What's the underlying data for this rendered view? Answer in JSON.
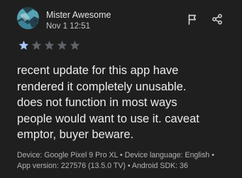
{
  "review": {
    "author": "Mister Awesome",
    "date": "Nov 1 12:51",
    "rating": 1,
    "max_rating": 5,
    "star_filled_color": "#a8c7fa",
    "star_empty_color": "#5f6368",
    "text": "recent update for this app have\nrendered it completely unusable.\ndoes not function in most ways\npeople would want to use it. caveat\nemptor, buyer beware.",
    "meta": "Device: Google Pixel 9 Pro XL • Device language: English •\nApp version: 227576 (13.5.0 TV) • Android SDK: 36"
  },
  "icons": {
    "avatar": "user-avatar",
    "flag": "flag-icon",
    "share": "share-icon",
    "star": "star-icon"
  },
  "colors": {
    "background": "#1f1f1f",
    "text_primary": "#ececec",
    "text_secondary": "#b4b4b4"
  }
}
